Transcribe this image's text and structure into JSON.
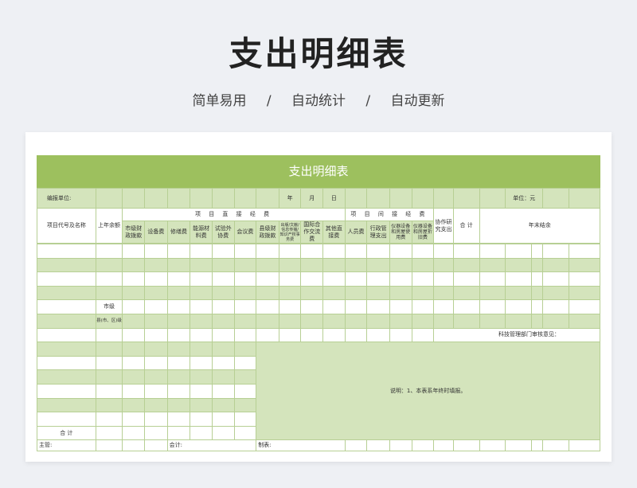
{
  "hero": {
    "title": "支出明细表",
    "tags": [
      "简单易用",
      "自动统计",
      "自动更新"
    ],
    "separator": "/"
  },
  "sheet": {
    "title": "支出明细表",
    "unit_label": "编报单位:",
    "year": "年",
    "month": "月",
    "day": "日",
    "currency": "单位：元",
    "col_project": "项目代号及名称",
    "col_prev_balance": "上年余额",
    "direct_header": "项 目 直 接 经 费",
    "indirect_header": "项 目 间 接 经 费",
    "direct_cols": [
      "市级财政拨款",
      "设备费",
      "修缮费",
      "能源材料费",
      "试验外协费",
      "会议费",
      "县级财政拨款",
      "出版/文献/信息传播/知识产权事务费",
      "国际合作交流费",
      "其他直接费"
    ],
    "indirect_cols": [
      "人员费",
      "行政管理支出",
      "仪器设备和房屋使用费",
      "仪器设备和房屋折旧费"
    ],
    "col_coop": "协作研究支出",
    "col_total": "合 计",
    "col_year_end": "年末结余",
    "row_city": "市级",
    "row_county": "县(市、区)级",
    "review_label": "科技管理部门审核意见：",
    "note": "说明：1、本表系年终时填报。",
    "sum_label": "合 计",
    "footer_main": "主管:",
    "footer_accountant": "会计:",
    "footer_maker": "制表:"
  }
}
